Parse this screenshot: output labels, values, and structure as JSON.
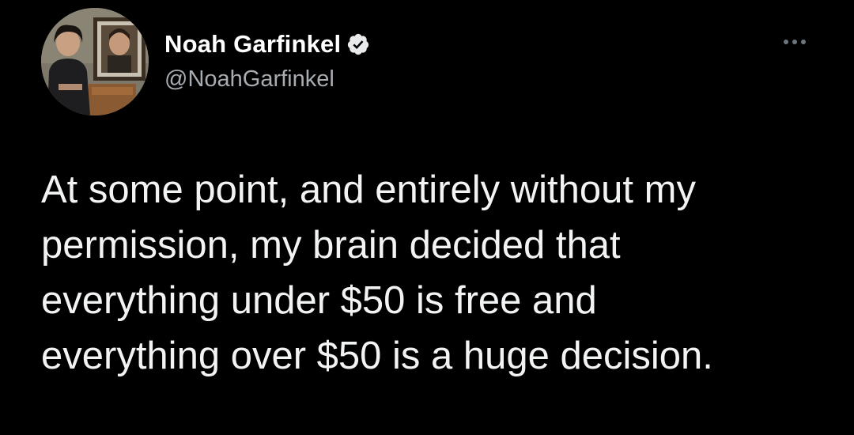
{
  "author": {
    "display_name": "Noah Garfinkel",
    "handle": "@NoahGarfinkel",
    "verified": true,
    "avatar_icon": "profile-photo",
    "verified_icon": "verified-badge-icon"
  },
  "actions": {
    "more_icon": "more-options-icon"
  },
  "tweet": {
    "text": "At some point, and entirely without my\npermission, my brain decided that\neverything under $50 is free and\neverything over $50 is a huge decision."
  },
  "colors": {
    "background": "#000000",
    "text": "#f2f3f4",
    "handle": "#a8adb2",
    "dots": "#6e767d"
  }
}
